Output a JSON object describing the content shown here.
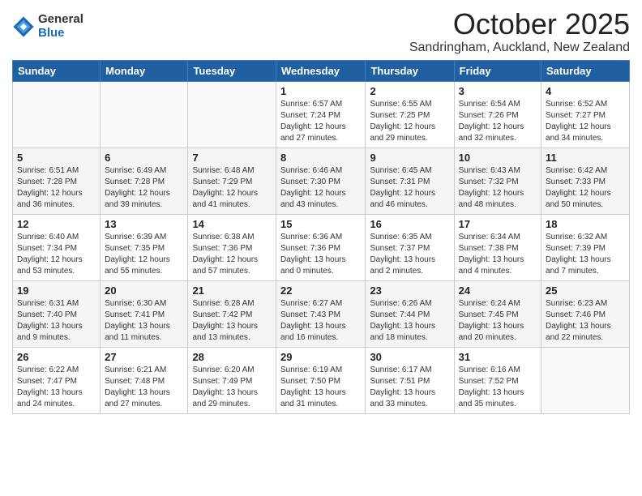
{
  "header": {
    "logo_general": "General",
    "logo_blue": "Blue",
    "month_title": "October 2025",
    "location": "Sandringham, Auckland, New Zealand"
  },
  "days_of_week": [
    "Sunday",
    "Monday",
    "Tuesday",
    "Wednesday",
    "Thursday",
    "Friday",
    "Saturday"
  ],
  "weeks": [
    [
      {
        "day": "",
        "info": ""
      },
      {
        "day": "",
        "info": ""
      },
      {
        "day": "",
        "info": ""
      },
      {
        "day": "1",
        "info": "Sunrise: 6:57 AM\nSunset: 7:24 PM\nDaylight: 12 hours\nand 27 minutes."
      },
      {
        "day": "2",
        "info": "Sunrise: 6:55 AM\nSunset: 7:25 PM\nDaylight: 12 hours\nand 29 minutes."
      },
      {
        "day": "3",
        "info": "Sunrise: 6:54 AM\nSunset: 7:26 PM\nDaylight: 12 hours\nand 32 minutes."
      },
      {
        "day": "4",
        "info": "Sunrise: 6:52 AM\nSunset: 7:27 PM\nDaylight: 12 hours\nand 34 minutes."
      }
    ],
    [
      {
        "day": "5",
        "info": "Sunrise: 6:51 AM\nSunset: 7:28 PM\nDaylight: 12 hours\nand 36 minutes."
      },
      {
        "day": "6",
        "info": "Sunrise: 6:49 AM\nSunset: 7:28 PM\nDaylight: 12 hours\nand 39 minutes."
      },
      {
        "day": "7",
        "info": "Sunrise: 6:48 AM\nSunset: 7:29 PM\nDaylight: 12 hours\nand 41 minutes."
      },
      {
        "day": "8",
        "info": "Sunrise: 6:46 AM\nSunset: 7:30 PM\nDaylight: 12 hours\nand 43 minutes."
      },
      {
        "day": "9",
        "info": "Sunrise: 6:45 AM\nSunset: 7:31 PM\nDaylight: 12 hours\nand 46 minutes."
      },
      {
        "day": "10",
        "info": "Sunrise: 6:43 AM\nSunset: 7:32 PM\nDaylight: 12 hours\nand 48 minutes."
      },
      {
        "day": "11",
        "info": "Sunrise: 6:42 AM\nSunset: 7:33 PM\nDaylight: 12 hours\nand 50 minutes."
      }
    ],
    [
      {
        "day": "12",
        "info": "Sunrise: 6:40 AM\nSunset: 7:34 PM\nDaylight: 12 hours\nand 53 minutes."
      },
      {
        "day": "13",
        "info": "Sunrise: 6:39 AM\nSunset: 7:35 PM\nDaylight: 12 hours\nand 55 minutes."
      },
      {
        "day": "14",
        "info": "Sunrise: 6:38 AM\nSunset: 7:36 PM\nDaylight: 12 hours\nand 57 minutes."
      },
      {
        "day": "15",
        "info": "Sunrise: 6:36 AM\nSunset: 7:36 PM\nDaylight: 13 hours\nand 0 minutes."
      },
      {
        "day": "16",
        "info": "Sunrise: 6:35 AM\nSunset: 7:37 PM\nDaylight: 13 hours\nand 2 minutes."
      },
      {
        "day": "17",
        "info": "Sunrise: 6:34 AM\nSunset: 7:38 PM\nDaylight: 13 hours\nand 4 minutes."
      },
      {
        "day": "18",
        "info": "Sunrise: 6:32 AM\nSunset: 7:39 PM\nDaylight: 13 hours\nand 7 minutes."
      }
    ],
    [
      {
        "day": "19",
        "info": "Sunrise: 6:31 AM\nSunset: 7:40 PM\nDaylight: 13 hours\nand 9 minutes."
      },
      {
        "day": "20",
        "info": "Sunrise: 6:30 AM\nSunset: 7:41 PM\nDaylight: 13 hours\nand 11 minutes."
      },
      {
        "day": "21",
        "info": "Sunrise: 6:28 AM\nSunset: 7:42 PM\nDaylight: 13 hours\nand 13 minutes."
      },
      {
        "day": "22",
        "info": "Sunrise: 6:27 AM\nSunset: 7:43 PM\nDaylight: 13 hours\nand 16 minutes."
      },
      {
        "day": "23",
        "info": "Sunrise: 6:26 AM\nSunset: 7:44 PM\nDaylight: 13 hours\nand 18 minutes."
      },
      {
        "day": "24",
        "info": "Sunrise: 6:24 AM\nSunset: 7:45 PM\nDaylight: 13 hours\nand 20 minutes."
      },
      {
        "day": "25",
        "info": "Sunrise: 6:23 AM\nSunset: 7:46 PM\nDaylight: 13 hours\nand 22 minutes."
      }
    ],
    [
      {
        "day": "26",
        "info": "Sunrise: 6:22 AM\nSunset: 7:47 PM\nDaylight: 13 hours\nand 24 minutes."
      },
      {
        "day": "27",
        "info": "Sunrise: 6:21 AM\nSunset: 7:48 PM\nDaylight: 13 hours\nand 27 minutes."
      },
      {
        "day": "28",
        "info": "Sunrise: 6:20 AM\nSunset: 7:49 PM\nDaylight: 13 hours\nand 29 minutes."
      },
      {
        "day": "29",
        "info": "Sunrise: 6:19 AM\nSunset: 7:50 PM\nDaylight: 13 hours\nand 31 minutes."
      },
      {
        "day": "30",
        "info": "Sunrise: 6:17 AM\nSunset: 7:51 PM\nDaylight: 13 hours\nand 33 minutes."
      },
      {
        "day": "31",
        "info": "Sunrise: 6:16 AM\nSunset: 7:52 PM\nDaylight: 13 hours\nand 35 minutes."
      },
      {
        "day": "",
        "info": ""
      }
    ]
  ]
}
